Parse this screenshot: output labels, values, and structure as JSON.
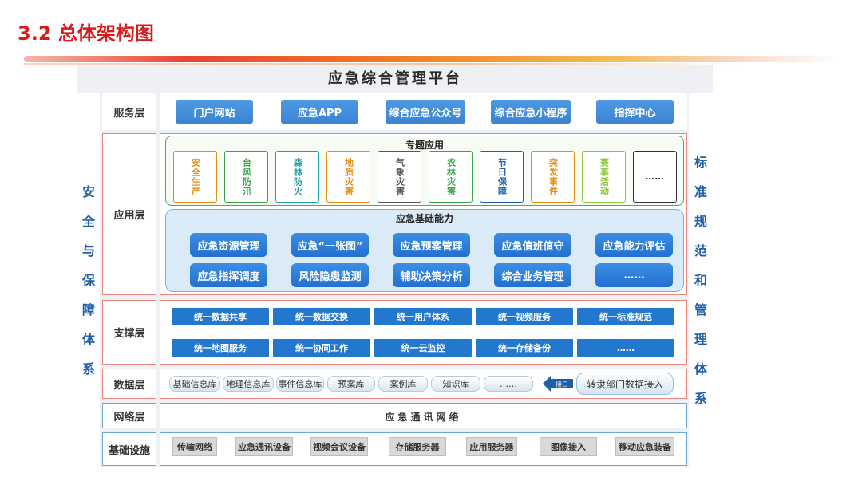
{
  "slide_title": "3.2 总体架构图",
  "platform_title": "应急综合管理平台",
  "left_column": [
    "安",
    "全",
    "与",
    "保",
    "障",
    "体",
    "系"
  ],
  "right_column": [
    "标",
    "准",
    "规",
    "范",
    "和",
    "管",
    "理",
    "体",
    "系"
  ],
  "layers": {
    "service": "服务层",
    "application": "应用层",
    "support": "支撑层",
    "data": "数据层",
    "network": "网络层",
    "infrastructure": "基础设施"
  },
  "service_items": [
    "门户网站",
    "应急APP",
    "综合应急公众号",
    "综合应急小程序",
    "指挥中心"
  ],
  "topics": {
    "title": "专题应用",
    "items": [
      {
        "label": "安全生产",
        "color": "#e88b12"
      },
      {
        "label": "台风防汛",
        "color": "#3aa34a"
      },
      {
        "label": "森林防火",
        "color": "#1aa4a8"
      },
      {
        "label": "地质灾害",
        "color": "#e88b12"
      },
      {
        "label": "气象灾害",
        "color": "#555555"
      },
      {
        "label": "农林灾害",
        "color": "#3aa34a"
      },
      {
        "label": "节日保障",
        "color": "#1f5fa8"
      },
      {
        "label": "突发事件",
        "color": "#e88b12"
      },
      {
        "label": "赛事活动",
        "color": "#8cc63e"
      },
      {
        "label": "……",
        "color": "#333333"
      }
    ]
  },
  "basic": {
    "title": "应急基础能力",
    "row1": [
      "应急资源管理",
      "应急“一张图”",
      "应急预案管理",
      "应急值班值守",
      "应急能力评估"
    ],
    "row2": [
      "应急指挥调度",
      "风险隐患监测",
      "辅助决策分析",
      "综合业务管理",
      "……"
    ]
  },
  "support": {
    "row1": [
      "统一数据共享",
      "统一数据交换",
      "统一用户体系",
      "统一视频服务",
      "统一标准规范"
    ],
    "row2": [
      "统一地图服务",
      "统一协同工作",
      "统一云监控",
      "统一存储备份",
      "……"
    ]
  },
  "data_items": [
    "基础信息库",
    "地理信息库",
    "事件信息库",
    "预案库",
    "案例库",
    "知识库",
    "……"
  ],
  "data_arrow_label": "接口",
  "data_access": "转隶部门数据接入",
  "network_text": "应急通讯网络",
  "infra_items": [
    "传输网络",
    "应急通讯设备",
    "视频会议设备",
    "存储服务器",
    "应用服务器",
    "图像接入",
    "移动应急装备"
  ],
  "colors": {
    "title_red": "#d91a1a",
    "side_blue": "#1f5fa8",
    "button_blue": "#2b73c9"
  }
}
